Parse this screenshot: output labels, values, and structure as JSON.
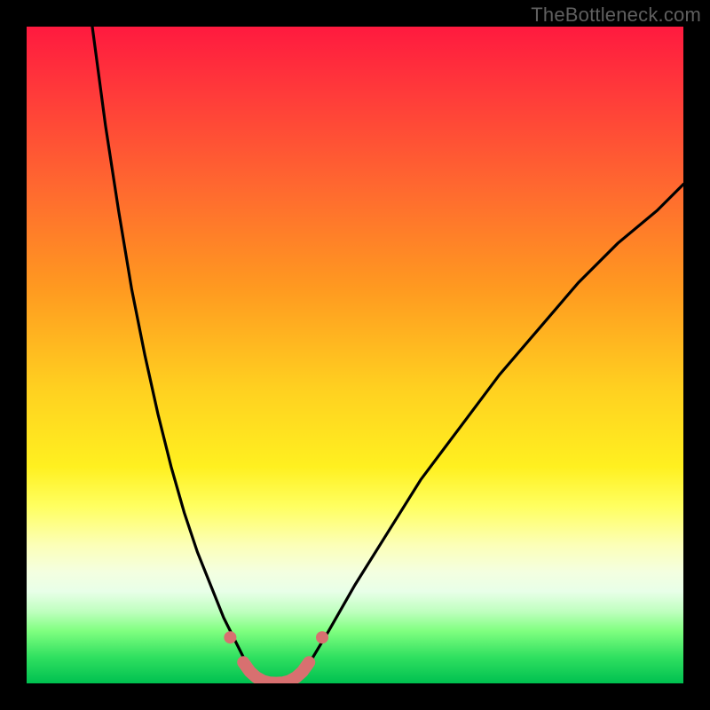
{
  "watermark": "TheBottleneck.com",
  "colors": {
    "frame": "#000000",
    "curve": "#000000",
    "accent_segment": "#d87070",
    "accent_dots": "#d87070"
  },
  "chart_data": {
    "type": "line",
    "title": "",
    "xlabel": "",
    "ylabel": "",
    "xlim": [
      0,
      100
    ],
    "ylim": [
      0,
      100
    ],
    "left_curve": {
      "x": [
        10,
        12,
        14,
        16,
        18,
        20,
        22,
        24,
        26,
        28,
        30,
        32,
        33.5,
        35
      ],
      "y": [
        100,
        85,
        72,
        60,
        50,
        41,
        33,
        26,
        20,
        15,
        10,
        6,
        3,
        0.5
      ]
    },
    "right_curve": {
      "x": [
        41,
        43,
        46,
        50,
        55,
        60,
        66,
        72,
        78,
        84,
        90,
        96,
        100
      ],
      "y": [
        0.5,
        3,
        8,
        15,
        23,
        31,
        39,
        47,
        54,
        61,
        67,
        72,
        76
      ]
    },
    "bottom_segment": {
      "x": [
        33,
        34,
        35,
        36,
        37,
        38,
        39,
        40,
        41,
        42,
        43
      ],
      "y": [
        3.2,
        1.8,
        0.9,
        0.35,
        0.1,
        0.05,
        0.1,
        0.35,
        0.9,
        1.8,
        3.2
      ]
    },
    "outer_dots": [
      {
        "x": 31.0,
        "y": 7.0
      },
      {
        "x": 45.0,
        "y": 7.0
      }
    ]
  }
}
